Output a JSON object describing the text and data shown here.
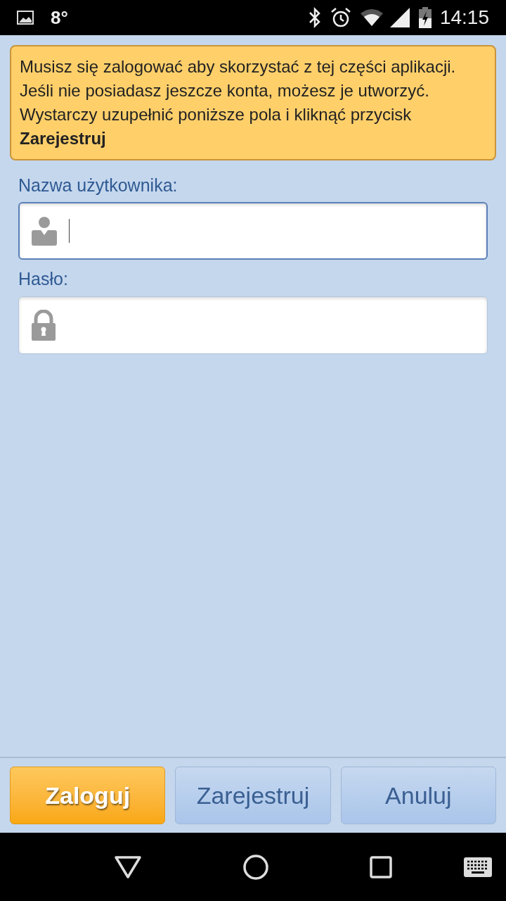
{
  "status_bar": {
    "temperature": "8°",
    "time": "14:15"
  },
  "notice": {
    "text": "Musisz się zalogować aby skorzystać z tej części aplikacji.\nJeśli nie posiadasz jeszcze konta, możesz je utworzyć. Wystarczy uzupełnić poniższe pola i kliknąć przycisk **Zarejestruj**"
  },
  "fields": [
    {
      "label": "Nazwa użytkownika:",
      "kind": "user",
      "focused": true
    },
    {
      "label": "Hasło:",
      "kind": "password",
      "focused": false
    }
  ],
  "buttons": [
    {
      "label": "Zaloguj",
      "kind": "primary"
    },
    {
      "label": "Zarejestruj",
      "kind": "secondary"
    },
    {
      "label": "Anuluj",
      "kind": "secondary"
    }
  ]
}
